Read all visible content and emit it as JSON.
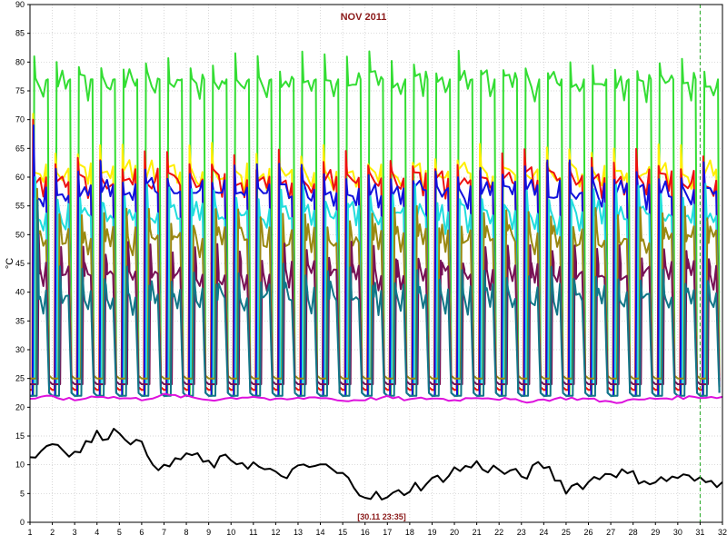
{
  "chart_data": {
    "type": "line",
    "title": "NOV 2011",
    "ylabel": "°C",
    "xlabel": "",
    "xlim": [
      1,
      32
    ],
    "ylim": [
      0,
      90
    ],
    "x_ticks": [
      "1",
      "2",
      "3",
      "4",
      "5",
      "6",
      "7",
      "8",
      "9",
      "10",
      "11",
      "12",
      "13",
      "14",
      "15",
      "16",
      "17",
      "18",
      "19",
      "20",
      "21",
      "22",
      "23",
      "24",
      "25",
      "26",
      "27",
      "28",
      "29",
      "30",
      "31",
      "32"
    ],
    "y_ticks": [
      "0",
      "5",
      "10",
      "15",
      "20",
      "25",
      "30",
      "35",
      "40",
      "45",
      "50",
      "55",
      "60",
      "65",
      "70",
      "75",
      "80",
      "85",
      "90"
    ],
    "grid": true,
    "marker_label": "[30.11 23:35]",
    "marker_x": 31,
    "series": [
      {
        "color": "#33dd33",
        "low": 21,
        "high": 77,
        "peak": 81,
        "phase": 0.15,
        "plateau": true
      },
      {
        "color": "#ffee00",
        "low": 22,
        "high": 61,
        "peak": 71,
        "phase": 0.1,
        "plateau": false
      },
      {
        "color": "#ee1111",
        "low": 22,
        "high": 60,
        "peak": 70,
        "phase": 0.1,
        "plateau": false
      },
      {
        "color": "#1111dd",
        "low": 21,
        "high": 58,
        "peak": 69,
        "phase": 0.12,
        "plateau": false
      },
      {
        "color": "#22dddd",
        "low": 23,
        "high": 54,
        "peak": 60,
        "phase": 0.2,
        "plateau": false
      },
      {
        "color": "#998811",
        "low": 24,
        "high": 50,
        "peak": 58,
        "phase": 0.28,
        "plateau": false
      },
      {
        "color": "#771155",
        "low": 23,
        "high": 44,
        "peak": 50,
        "phase": 0.35,
        "plateau": false
      },
      {
        "color": "#117788",
        "low": 21,
        "high": 40,
        "peak": 56,
        "phase": 0.3,
        "plateau": false
      },
      {
        "color": "#dd11dd",
        "daily": [
          21.5,
          21.8,
          21.2,
          22.0,
          21.6,
          21.4,
          22.1,
          21.8,
          21.3,
          21.6,
          21.9,
          21.2,
          21.5,
          21.8,
          21.1,
          21.4,
          21.7,
          21.3,
          21.6,
          21.2,
          21.8,
          21.5,
          21.0,
          21.3,
          21.6,
          21.4,
          20.9,
          21.2,
          21.5,
          21.7,
          21.8
        ]
      },
      {
        "color": "#000000",
        "daily": [
          11,
          14,
          12,
          15,
          16,
          13,
          9,
          12,
          10,
          11,
          10,
          8,
          9,
          10,
          8,
          5,
          4,
          6,
          7,
          9,
          10,
          9,
          8,
          10,
          6,
          7,
          9,
          8,
          7,
          8,
          7
        ]
      }
    ]
  }
}
